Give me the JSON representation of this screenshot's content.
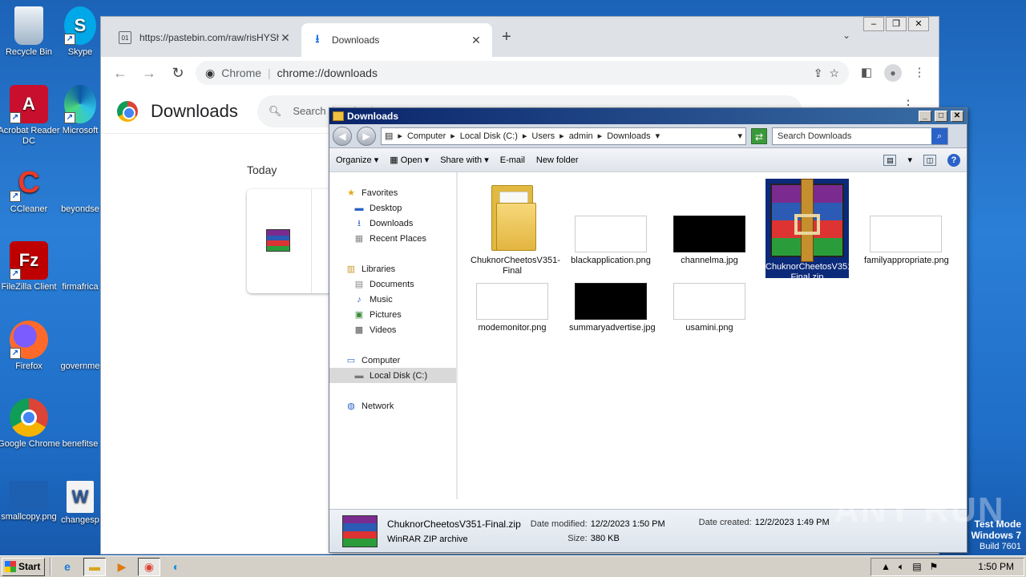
{
  "desktop": {
    "icons_col1": [
      {
        "label": "Recycle Bin",
        "icon": "recycle-bin-icon"
      },
      {
        "label": "Acrobat Reader DC",
        "icon": "acrobat-icon"
      },
      {
        "label": "CCleaner",
        "icon": "ccleaner-icon"
      },
      {
        "label": "FileZilla Client",
        "icon": "filezilla-icon"
      },
      {
        "label": "Firefox",
        "icon": "firefox-icon"
      },
      {
        "label": "Google Chrome",
        "icon": "chrome-icon"
      },
      {
        "label": "smallcopy.png",
        "icon": "image-file-icon"
      }
    ],
    "icons_col2": [
      {
        "label": "Skype",
        "icon": "skype-icon"
      },
      {
        "label": "Microsoft",
        "icon": "edge-icon"
      },
      {
        "label": "beyondse",
        "icon": "file-icon"
      },
      {
        "label": "firmafrica",
        "icon": "file-icon"
      },
      {
        "label": "governme",
        "icon": "file-icon"
      },
      {
        "label": "benefitse",
        "icon": "file-icon"
      },
      {
        "label": "changesp",
        "icon": "word-icon"
      }
    ]
  },
  "chrome": {
    "tabs": [
      {
        "title": "https://pastebin.com/raw/risHYShF",
        "icon": "pastebin-icon",
        "active": false
      },
      {
        "title": "Downloads",
        "icon": "download-icon",
        "active": true
      }
    ],
    "omnibox": {
      "site": "Chrome",
      "url": "chrome://downloads"
    },
    "page_title": "Downloads",
    "search_placeholder": "Search downloads",
    "section_label": "Today"
  },
  "explorer": {
    "title": "Downloads",
    "breadcrumb": [
      "Computer",
      "Local Disk (C:)",
      "Users",
      "admin",
      "Downloads"
    ],
    "search_placeholder": "Search Downloads",
    "commands": {
      "organize": "Organize",
      "open": "Open",
      "share": "Share with",
      "email": "E-mail",
      "new_folder": "New folder"
    },
    "nav": {
      "favorites": "Favorites",
      "desktop": "Desktop",
      "downloads": "Downloads",
      "recent": "Recent Places",
      "libraries": "Libraries",
      "documents": "Documents",
      "music": "Music",
      "pictures": "Pictures",
      "videos": "Videos",
      "computer": "Computer",
      "local_disk": "Local Disk (C:)",
      "network": "Network"
    },
    "files": [
      {
        "name": "ChuknorCheetosV351-Final",
        "kind": "folder"
      },
      {
        "name": "blackapplication.png",
        "kind": "white"
      },
      {
        "name": "channelma.jpg",
        "kind": "black"
      },
      {
        "name": "ChuknorCheetosV351-Final.zip",
        "kind": "rar",
        "selected": true
      },
      {
        "name": "familyappropriate.png",
        "kind": "white"
      },
      {
        "name": "modemonitor.png",
        "kind": "white"
      },
      {
        "name": "summaryadvertise.jpg",
        "kind": "black"
      },
      {
        "name": "usamini.png",
        "kind": "white"
      }
    ],
    "status": {
      "name": "ChuknorCheetosV351-Final.zip",
      "type": "WinRAR ZIP archive",
      "modified_label": "Date modified:",
      "modified": "12/2/2023 1:50 PM",
      "size_label": "Size:",
      "size": "380 KB",
      "created_label": "Date created:",
      "created": "12/2/2023 1:49 PM"
    }
  },
  "watermark": "ANY RUN",
  "os_build": {
    "line1": "Test Mode",
    "line2": "Windows 7",
    "line3": "Build 7601"
  },
  "taskbar": {
    "start": "Start",
    "clock": "1:50 PM"
  },
  "colors": {
    "selection": "#0c2a7a",
    "titlebar": "#0a246a",
    "desktop": "#2b7fd6"
  }
}
